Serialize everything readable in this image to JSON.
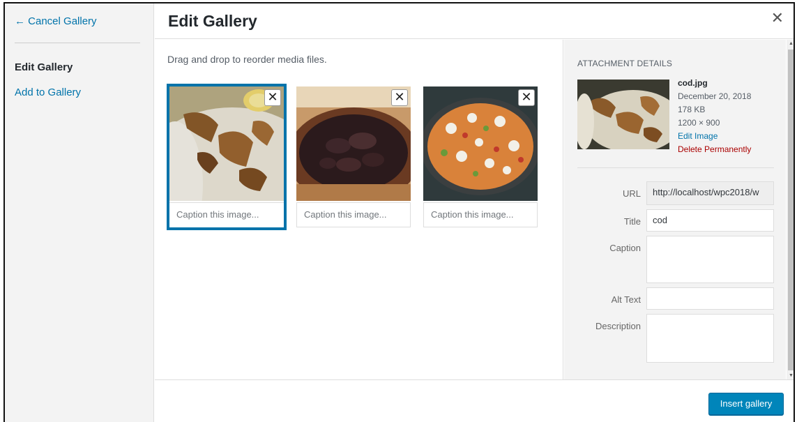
{
  "menu": {
    "cancel_label": "← Cancel Gallery",
    "items": [
      {
        "label": "Edit Gallery"
      },
      {
        "label": "Add to Gallery"
      }
    ]
  },
  "header": {
    "title": "Edit Gallery",
    "close_glyph": "✕"
  },
  "content": {
    "instructions": "Drag and drop to reorder media files.",
    "attachments": [
      {
        "name": "cod",
        "caption_placeholder": "Caption this image...",
        "selected": true
      },
      {
        "name": "mussels",
        "caption_placeholder": "Caption this image...",
        "selected": false
      },
      {
        "name": "paella",
        "caption_placeholder": "Caption this image...",
        "selected": false
      }
    ],
    "remove_glyph": "✕"
  },
  "details": {
    "heading": "ATTACHMENT DETAILS",
    "filename": "cod.jpg",
    "date": "December 20, 2018",
    "filesize": "178 KB",
    "dimensions": "1200 × 900",
    "edit_link": "Edit Image",
    "delete_link": "Delete Permanently",
    "fields": {
      "url": {
        "label": "URL",
        "value": "http://localhost/wpc2018/w"
      },
      "title": {
        "label": "Title",
        "value": "cod"
      },
      "caption": {
        "label": "Caption",
        "value": ""
      },
      "alt": {
        "label": "Alt Text",
        "value": ""
      },
      "description": {
        "label": "Description",
        "value": ""
      }
    }
  },
  "footer": {
    "insert_label": "Insert gallery"
  },
  "colors": {
    "accent": "#0073aa",
    "primary_button": "#0085ba",
    "delete": "#a00"
  }
}
